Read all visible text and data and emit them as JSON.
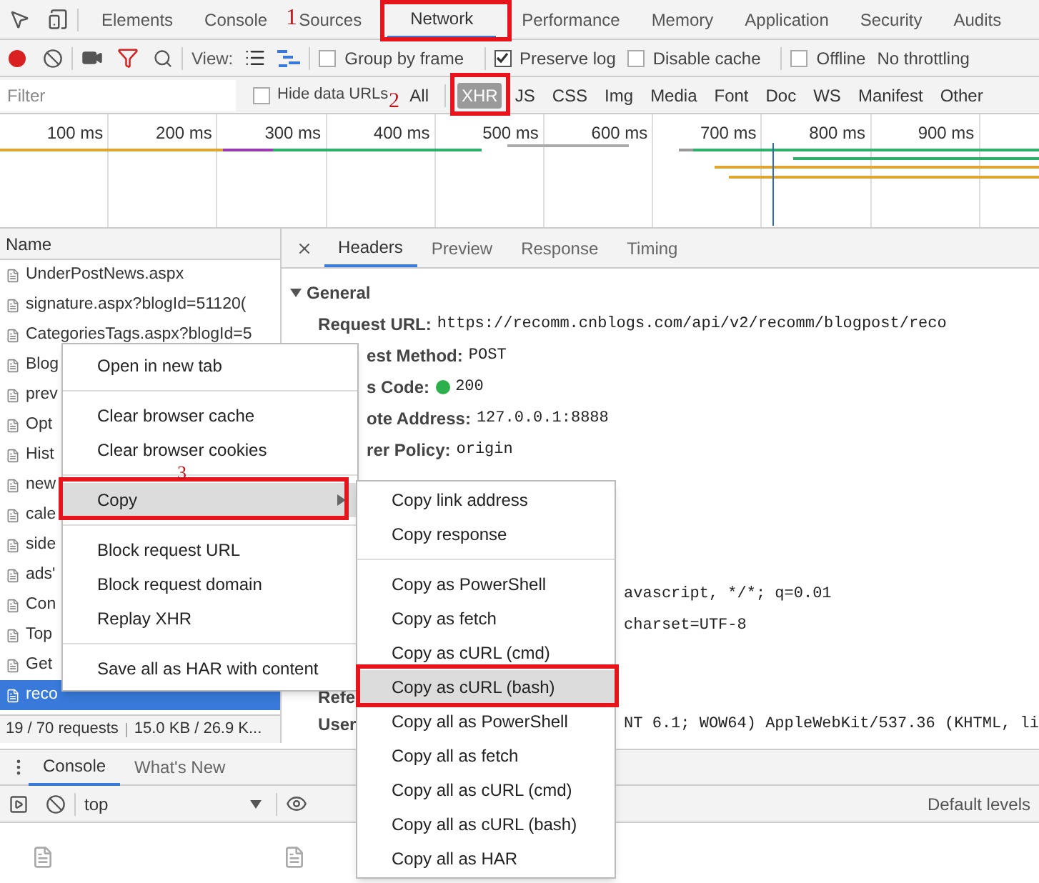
{
  "panel_tabs": [
    {
      "label": "Elements",
      "selected": false
    },
    {
      "label": "Console",
      "selected": false
    },
    {
      "label": "Sources",
      "selected": false
    },
    {
      "label": "Network",
      "selected": true
    },
    {
      "label": "Performance",
      "selected": false
    },
    {
      "label": "Memory",
      "selected": false
    },
    {
      "label": "Application",
      "selected": false
    },
    {
      "label": "Security",
      "selected": false
    },
    {
      "label": "Audits",
      "selected": false
    }
  ],
  "network_toolbar": {
    "recording": true,
    "view_label": "View:",
    "options": [
      {
        "label": "Group by frame",
        "checked": false
      },
      {
        "label": "Preserve log",
        "checked": true
      },
      {
        "label": "Disable cache",
        "checked": false
      },
      {
        "label": "Offline",
        "checked": false
      }
    ],
    "throttling": "No throttling"
  },
  "filter": {
    "placeholder": "Filter",
    "hide_data_urls": {
      "label": "Hide data URLs",
      "checked": false
    },
    "types": [
      {
        "label": "All",
        "selected": false
      },
      {
        "label": "XHR",
        "selected": true
      },
      {
        "label": "JS",
        "selected": false
      },
      {
        "label": "CSS",
        "selected": false
      },
      {
        "label": "Img",
        "selected": false
      },
      {
        "label": "Media",
        "selected": false
      },
      {
        "label": "Font",
        "selected": false
      },
      {
        "label": "Doc",
        "selected": false
      },
      {
        "label": "WS",
        "selected": false
      },
      {
        "label": "Manifest",
        "selected": false
      },
      {
        "label": "Other",
        "selected": false
      }
    ]
  },
  "timeline": {
    "ticks": [
      "100 ms",
      "200 ms",
      "300 ms",
      "400 ms",
      "500 ms",
      "600 ms",
      "700 ms",
      "800 ms",
      "900 ms"
    ]
  },
  "requests": {
    "column": "Name",
    "rows": [
      {
        "name": "UnderPostNews.aspx",
        "selected": false
      },
      {
        "name": "signature.aspx?blogId=51120(",
        "selected": false
      },
      {
        "name": "CategoriesTags.aspx?blogId=5",
        "selected": false
      },
      {
        "name": "Blog",
        "selected": false
      },
      {
        "name": "prev",
        "selected": false
      },
      {
        "name": "Opt",
        "selected": false
      },
      {
        "name": "Hist",
        "selected": false
      },
      {
        "name": "new",
        "selected": false
      },
      {
        "name": "cale",
        "selected": false
      },
      {
        "name": "side",
        "selected": false
      },
      {
        "name": "ads'",
        "selected": false
      },
      {
        "name": "Con",
        "selected": false
      },
      {
        "name": "Top",
        "selected": false
      },
      {
        "name": "Get",
        "selected": false
      },
      {
        "name": "reco",
        "selected": true
      }
    ]
  },
  "details": {
    "tabs": [
      {
        "label": "Headers",
        "selected": true
      },
      {
        "label": "Preview",
        "selected": false
      },
      {
        "label": "Response",
        "selected": false
      },
      {
        "label": "Timing",
        "selected": false
      }
    ],
    "section": "General",
    "rows": [
      {
        "kind": "full",
        "label": "Request URL:",
        "value": "https://recomm.cnblogs.com/api/v2/recomm/blogpost/reco"
      },
      {
        "kind": "clipped",
        "label": "est Method:",
        "value": "POST"
      },
      {
        "kind": "status",
        "label": "s Code:",
        "value": "200"
      },
      {
        "kind": "clipped",
        "label": "ote Address:",
        "value": "127.0.0.1:8888"
      },
      {
        "kind": "clipped",
        "label": "rer Policy:",
        "value": "origin"
      },
      {
        "kind": "gap"
      },
      {
        "kind": "fragment",
        "value": "avascript, */*; q=0.01"
      },
      {
        "kind": "fragment",
        "value": "charset=UTF-8"
      },
      {
        "kind": "label",
        "label": "Refe"
      },
      {
        "kind": "split",
        "label": "User",
        "value": "NT 6.1; WOW64) AppleWebKit/537.36 (KHTML, li"
      }
    ]
  },
  "status_bar": {
    "requests": "19 / 70 requests",
    "size": "15.0 KB / 26.9 K..."
  },
  "drawer": {
    "tabs": [
      {
        "label": "Console",
        "selected": true
      },
      {
        "label": "What's New",
        "selected": false
      }
    ],
    "context": "top",
    "levels": "Default levels"
  },
  "context_menu": {
    "groups": [
      [
        {
          "label": "Open in new tab",
          "selected": false,
          "submenu": false
        }
      ],
      [
        {
          "label": "Clear browser cache",
          "selected": false,
          "submenu": false
        },
        {
          "label": "Clear browser cookies",
          "selected": false,
          "submenu": false
        }
      ],
      [
        {
          "label": "Copy",
          "selected": true,
          "submenu": true
        }
      ],
      [
        {
          "label": "Block request URL",
          "selected": false,
          "submenu": false
        },
        {
          "label": "Block request domain",
          "selected": false,
          "submenu": false
        },
        {
          "label": "Replay XHR",
          "selected": false,
          "submenu": false
        }
      ],
      [
        {
          "label": "Save all as HAR with content",
          "selected": false,
          "submenu": false
        }
      ]
    ]
  },
  "copy_submenu": {
    "groups": [
      [
        {
          "label": "Copy link address",
          "selected": false
        },
        {
          "label": "Copy response",
          "selected": false
        }
      ],
      [
        {
          "label": "Copy as PowerShell",
          "selected": false
        },
        {
          "label": "Copy as fetch",
          "selected": false
        },
        {
          "label": "Copy as cURL (cmd)",
          "selected": false
        },
        {
          "label": "Copy as cURL (bash)",
          "selected": true
        },
        {
          "label": "Copy all as PowerShell",
          "selected": false
        },
        {
          "label": "Copy all as fetch",
          "selected": false
        },
        {
          "label": "Copy all as cURL (cmd)",
          "selected": false
        },
        {
          "label": "Copy all as cURL (bash)",
          "selected": false
        },
        {
          "label": "Copy all as HAR",
          "selected": false
        }
      ]
    ]
  },
  "annotations": [
    {
      "label": "1"
    },
    {
      "label": "2"
    },
    {
      "label": "3"
    }
  ]
}
